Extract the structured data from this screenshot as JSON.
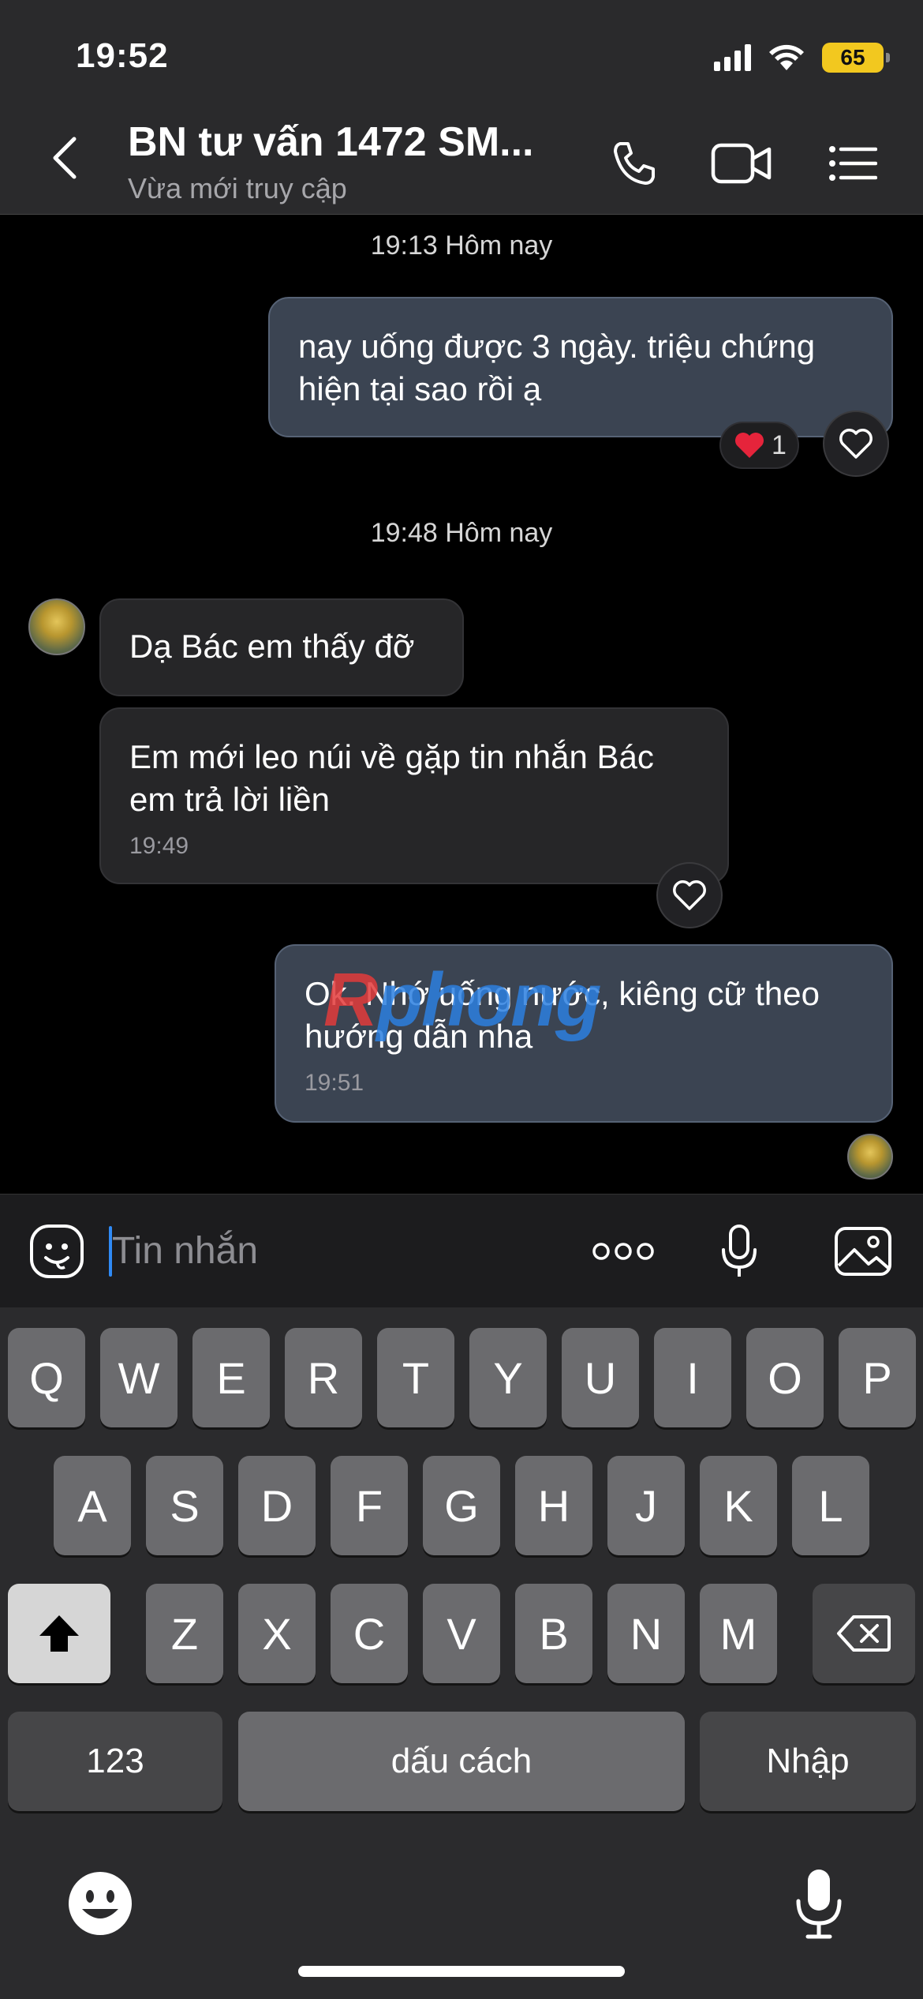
{
  "status": {
    "time": "19:52",
    "battery": "65"
  },
  "header": {
    "title": "BN tư vấn 1472 SM...",
    "subtitle": "Vừa mới truy cập"
  },
  "messages": {
    "ts1": "19:13 Hôm nay",
    "m1": "nay uống được 3 ngày. triệu chứng hiện tại sao rồi ạ",
    "m1_reaction_count": "1",
    "ts2": "19:48 Hôm nay",
    "m2": "Dạ Bác em thấy đỡ",
    "m3": "Em mới leo núi về gặp tin nhắn Bác em trả lời liền",
    "m3_time": "19:49",
    "m4": "Ok. Nhớ uống nước, kiêng cữ theo hướng dẫn nha",
    "m4_time": "19:51"
  },
  "watermark": {
    "part1": "R",
    "part2": "phong"
  },
  "input": {
    "placeholder": "Tin nhắn"
  },
  "keyboard": {
    "row1": [
      "Q",
      "W",
      "E",
      "R",
      "T",
      "Y",
      "U",
      "I",
      "O",
      "P"
    ],
    "row2": [
      "A",
      "S",
      "D",
      "F",
      "G",
      "H",
      "J",
      "K",
      "L"
    ],
    "row3": [
      "Z",
      "X",
      "C",
      "V",
      "B",
      "N",
      "M"
    ],
    "numbers": "123",
    "space": "dấu cách",
    "enter": "Nhập"
  },
  "icons": {
    "back": "chevron-left-icon",
    "call": "phone-icon",
    "video": "video-icon",
    "menu": "list-icon",
    "sticker": "emoji-sticker-icon",
    "more": "more-dots-icon",
    "mic": "microphone-icon",
    "gallery": "image-icon",
    "heart": "heart-icon",
    "shift": "shift-icon",
    "delete": "backspace-icon",
    "emoji": "emoji-icon"
  },
  "colors": {
    "accent": "#2f8af5",
    "reaction": "#e5243b",
    "battery": "#f2c81f"
  }
}
